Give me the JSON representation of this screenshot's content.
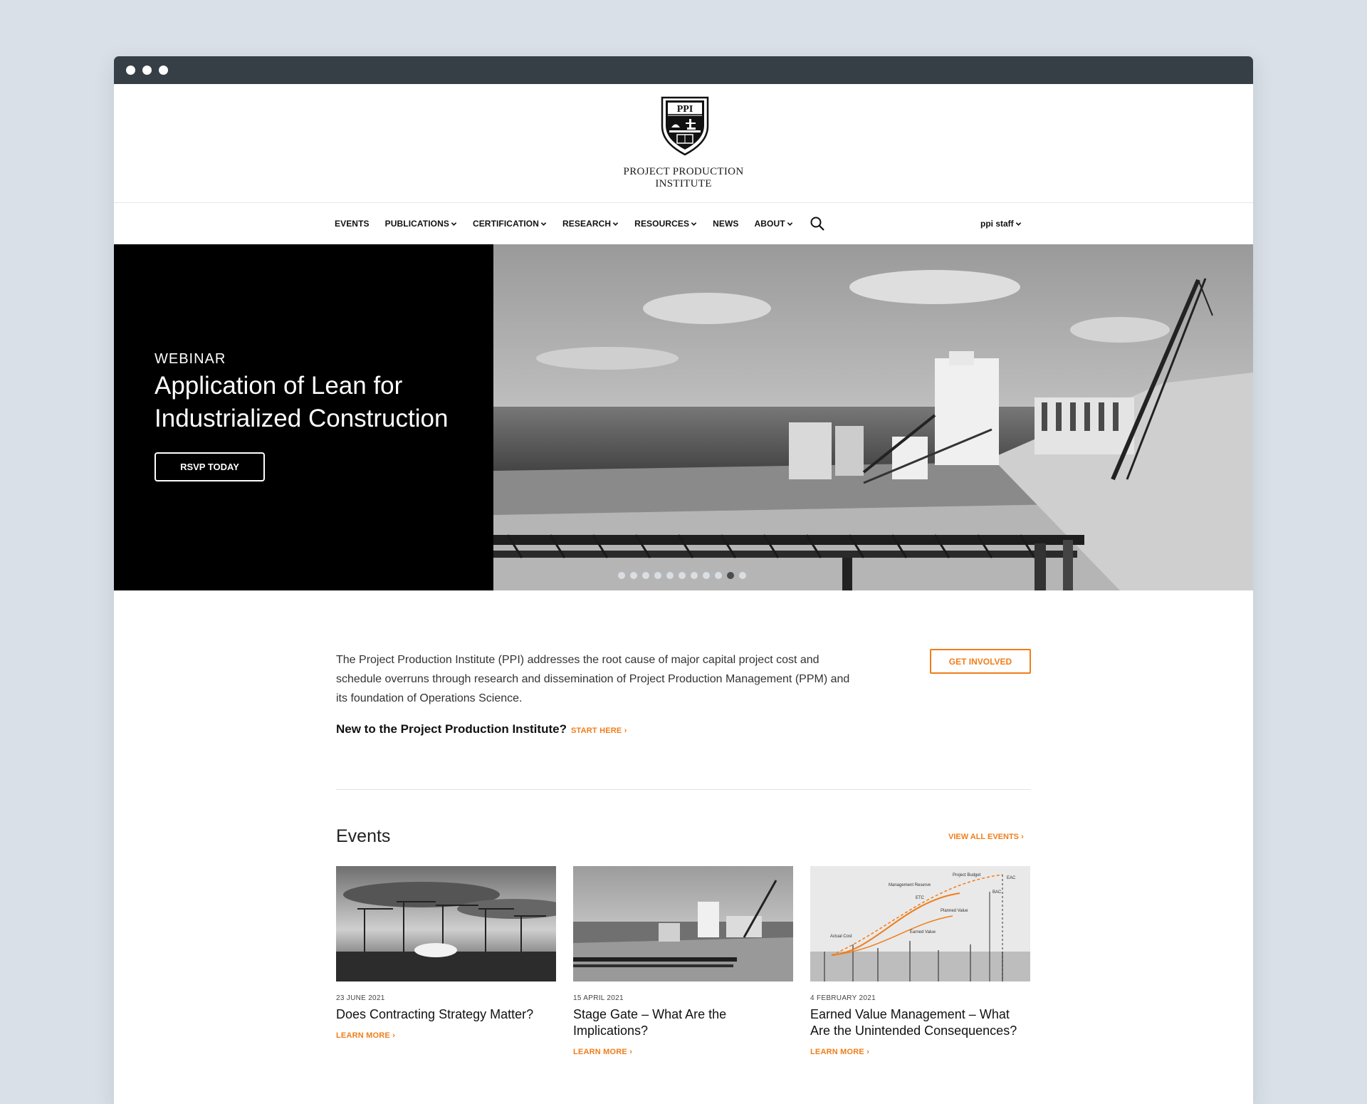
{
  "window": {
    "dots": 3
  },
  "logo": {
    "crest_text": "PPI",
    "line1": "PROJECT PRODUCTION",
    "line2": "INSTITUTE"
  },
  "nav": {
    "items": [
      {
        "label": "EVENTS",
        "dropdown": false
      },
      {
        "label": "PUBLICATIONS",
        "dropdown": true
      },
      {
        "label": "CERTIFICATION",
        "dropdown": true
      },
      {
        "label": "RESEARCH",
        "dropdown": true
      },
      {
        "label": "RESOURCES",
        "dropdown": true
      },
      {
        "label": "NEWS",
        "dropdown": false
      },
      {
        "label": "ABOUT",
        "dropdown": true
      }
    ],
    "search_icon": "search-icon",
    "user_label": "ppi staff"
  },
  "hero": {
    "kicker": "WEBINAR",
    "title": "Application of Lean for Industrialized Construction",
    "button": "RSVP TODAY",
    "slide_count": 11,
    "active_slide": 10
  },
  "intro": {
    "text": "The Project Production Institute (PPI) addresses the root cause of major capital project cost and schedule overruns through research and dissemination of Project Production Management (PPM) and its foundation of Operations Science.",
    "get_involved": "GET INVOLVED",
    "new_to": "New to the Project Production Institute?",
    "start_here": "START HERE ›"
  },
  "events": {
    "title": "Events",
    "view_all": "VIEW ALL EVENTS ›",
    "cards": [
      {
        "date": "23 JUNE 2021",
        "title": "Does Contracting Strategy Matter?",
        "link": "LEARN MORE ›"
      },
      {
        "date": "15 APRIL 2021",
        "title": "Stage Gate – What Are the Implications?",
        "link": "LEARN MORE ›"
      },
      {
        "date": "4 FEBRUARY 2021",
        "title": "Earned Value Management – What Are the Unintended Consequences?",
        "link": "LEARN MORE ›",
        "chart_labels": {
          "project_budget": "Project Budget",
          "eac": "EAC",
          "management_reserve": "Management Reserve",
          "etc": "ETC",
          "bac": "BAC",
          "planned_value": "Planned Value",
          "actual_cost": "Actual Cost",
          "earned_value": "Earned Value"
        }
      }
    ]
  },
  "colors": {
    "accent": "#f07d1a",
    "titlebar": "#363f45",
    "background": "#d9e0e8"
  }
}
